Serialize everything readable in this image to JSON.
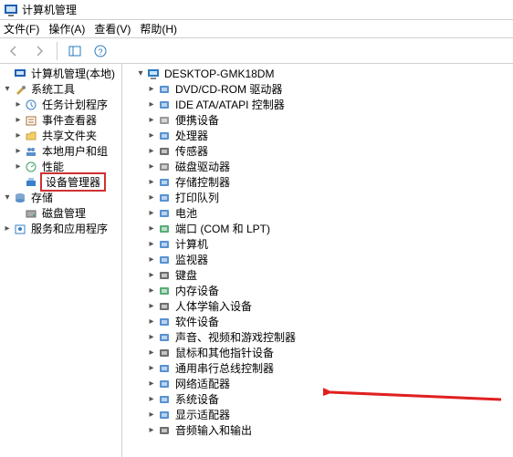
{
  "title": "计算机管理",
  "menubar": {
    "file": "文件(F)",
    "action": "操作(A)",
    "view": "查看(V)",
    "help": "帮助(H)"
  },
  "left_tree": {
    "root": "计算机管理(本地)",
    "system_tools": "系统工具",
    "task_scheduler": "任务计划程序",
    "event_viewer": "事件查看器",
    "shared_folders": "共享文件夹",
    "local_users": "本地用户和组",
    "performance": "性能",
    "device_manager": "设备管理器",
    "storage": "存储",
    "disk_management": "磁盘管理",
    "services_apps": "服务和应用程序"
  },
  "right_tree": {
    "computer": "DESKTOP-GMK18DM",
    "items": [
      "DVD/CD-ROM 驱动器",
      "IDE ATA/ATAPI 控制器",
      "便携设备",
      "处理器",
      "传感器",
      "磁盘驱动器",
      "存储控制器",
      "打印队列",
      "电池",
      "端口 (COM 和 LPT)",
      "计算机",
      "监视器",
      "键盘",
      "内存设备",
      "人体学输入设备",
      "软件设备",
      "声音、视频和游戏控制器",
      "鼠标和其他指针设备",
      "通用串行总线控制器",
      "网络适配器",
      "系统设备",
      "显示适配器",
      "音频输入和输出"
    ],
    "pointed_index": 20
  },
  "icons": {
    "appicon_color": "#1f5fb0",
    "category_colors": [
      "#3a7fc9",
      "#3a7fc9",
      "#888",
      "#3a7fc9",
      "#555",
      "#777",
      "#3a7fc9",
      "#3a7fc9",
      "#3a7fc9",
      "#3a9f5f",
      "#3a7fc9",
      "#3a7fc9",
      "#555",
      "#3a9f5f",
      "#555",
      "#3a7fc9",
      "#3a7fc9",
      "#555",
      "#3a7fc9",
      "#3a7fc9",
      "#3a7fc9",
      "#3a7fc9",
      "#555"
    ]
  }
}
